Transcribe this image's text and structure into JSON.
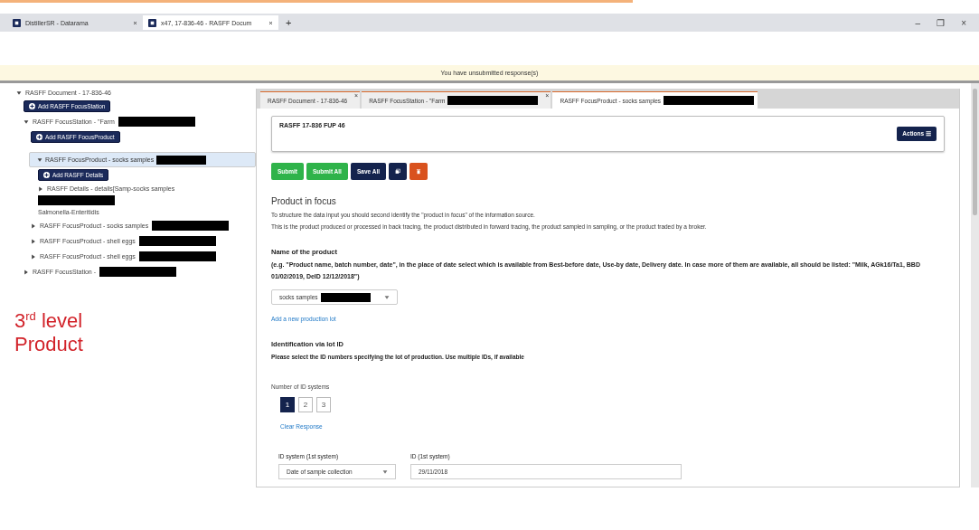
{
  "browser": {
    "tabs": [
      {
        "label": "DistillerSR - Datarama",
        "selected": false
      },
      {
        "label": "x47, 17-836-46 - RASFF Docum",
        "selected": true
      }
    ],
    "new_tab": "+",
    "controls": [
      "–",
      "❐",
      "×"
    ]
  },
  "banner": "You have unsubmitted response(s)",
  "tree": [
    {
      "label": "RASFF Document - 17-836-46",
      "redacted": false,
      "expanded": true,
      "selected": false,
      "add_button": "Add RASFF FocusStation",
      "children": [
        {
          "label": "RASFF FocusStation - \"Farm",
          "redacted": true,
          "expanded": true,
          "selected": false,
          "add_button": "Add RASFF FocusProduct",
          "children": [
            {
              "label": "RASFF FocusProduct - socks samples",
              "redacted": true,
              "expanded": true,
              "selected": true,
              "add_button": "Add RASFF Details",
              "children": [
                {
                  "label": "RASFF Details - details[Samp-socks samples",
                  "redacted": true,
                  "suffix": "Salmonella-Enteritidis",
                  "expanded": false,
                  "selected": false
                }
              ]
            },
            {
              "label": "RASFF FocusProduct - socks samples",
              "redacted": true,
              "expanded": false,
              "selected": false
            },
            {
              "label": "RASFF FocusProduct - shell eggs",
              "redacted": true,
              "expanded": false,
              "selected": false
            },
            {
              "label": "RASFF FocusProduct - shell eggs",
              "redacted": true,
              "expanded": false,
              "selected": false
            }
          ]
        },
        {
          "label": "RASFF FocusStation -",
          "redacted": true,
          "expanded": false,
          "selected": false
        }
      ]
    }
  ],
  "annotation": "3$^{rd}$ level Product",
  "doc_tabs": [
    {
      "label": "RASFF Document - 17-836-46",
      "redacted": false,
      "close": "×",
      "selected": false
    },
    {
      "label": "RASFF FocusStation - \"Farm",
      "redacted": true,
      "close": "×",
      "selected": false
    },
    {
      "label": "RASFF FocusProduct - socks samples",
      "redacted": true,
      "selected": true
    }
  ],
  "record": {
    "title": "RASFF 17-836 FUP 46",
    "actions": "Actions ☰"
  },
  "buttons": [
    {
      "kind": "green",
      "label": "Submit"
    },
    {
      "kind": "green",
      "label": "Submit All"
    },
    {
      "kind": "navy",
      "label": "Save All"
    },
    {
      "kind": "copy"
    },
    {
      "kind": "delete"
    }
  ],
  "section": {
    "title": "Product in focus",
    "paragraphs": [
      "To structure the data input you should second identify the \"product in focus\" of the information source.",
      "This is the product produced or processed in back tracing, the product distributed in forward tracing, the product sampled in sampling, or the product traded by a broker."
    ]
  },
  "product_name": {
    "label": "Name of the product",
    "hint": "(e.g. \"Product name, batch number, date\", in the place of date select which is available from Best-before date, Use-by date, Delivery date. In case more of them are available, all should be listed: \"Milk, AGk16/Ta1, BBD 01/02/2019, DelD 12/12/2018\")",
    "value": "socks samples",
    "link": "Add a new production lot"
  },
  "lot": {
    "title": "Identification via lot ID",
    "description": "Please select the ID numbers specifying the lot of production. Use multiple IDs, if available",
    "count_label": "Number of ID systems",
    "options": [
      {
        "label": "1",
        "selected": true
      },
      {
        "label": "2",
        "selected": false
      },
      {
        "label": "3",
        "selected": false
      }
    ],
    "clear": "Clear Response",
    "system_label": "ID system (1st system)",
    "system_value": "Date of sample collection",
    "id_label": "ID (1st system)",
    "id_value": "29/11/2018"
  }
}
